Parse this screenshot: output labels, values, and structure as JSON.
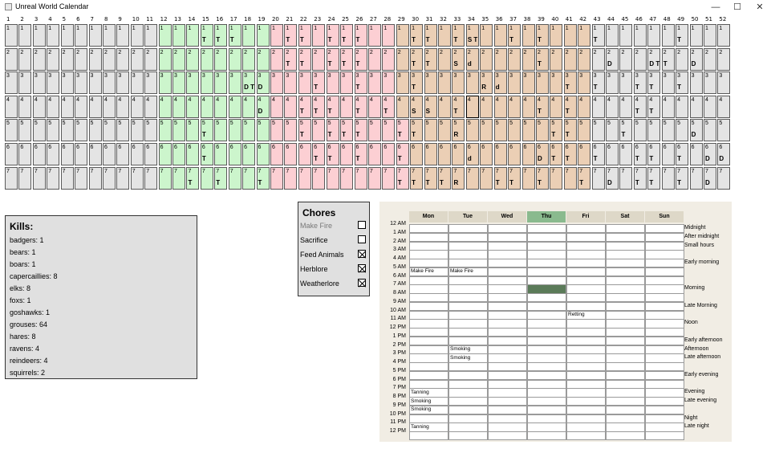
{
  "window": {
    "title": "Unreal World Calendar",
    "minimize": "—",
    "maximize": "☐",
    "close": "✕"
  },
  "calendar": {
    "weeks": [
      "1",
      "2",
      "3",
      "4",
      "5",
      "6",
      "7",
      "8",
      "9",
      "10",
      "11",
      "12",
      "13",
      "14",
      "15",
      "16",
      "17",
      "18",
      "19",
      "20",
      "21",
      "22",
      "23",
      "24",
      "25",
      "26",
      "27",
      "28",
      "29",
      "30",
      "31",
      "32",
      "33",
      "34",
      "35",
      "36",
      "37",
      "38",
      "39",
      "40",
      "41",
      "42",
      "43",
      "44",
      "45",
      "46",
      "47",
      "48",
      "49",
      "50",
      "51",
      "52"
    ],
    "days": [
      "1",
      "2",
      "3",
      "4",
      "5",
      "6",
      "7"
    ],
    "season_colors": {
      "winter": "#e4e4e4",
      "spring": "#ccf5cc",
      "summer": "#fccfd3",
      "autumn": "#ebcfb5"
    },
    "season_ranges": [
      {
        "season": "winter",
        "from": 1,
        "to": 11
      },
      {
        "season": "spring",
        "from": 12,
        "to": 19
      },
      {
        "season": "summer",
        "from": 20,
        "to": 28
      },
      {
        "season": "autumn",
        "from": 29,
        "to": 42
      },
      {
        "season": "winter",
        "from": 43,
        "to": 52
      }
    ],
    "season_exceptions": [
      {
        "week": 20,
        "day": 6,
        "season": "summer"
      },
      {
        "week": 20,
        "day": 7,
        "season": "summer"
      },
      {
        "week": 29,
        "day": 5,
        "season": "summer"
      },
      {
        "week": 29,
        "day": 6,
        "season": "summer"
      },
      {
        "week": 29,
        "day": 7,
        "season": "summer"
      }
    ],
    "selected": {
      "week": 34,
      "day": 4
    },
    "marks": [
      {
        "week": 15,
        "day": 1,
        "text": "T"
      },
      {
        "week": 16,
        "day": 1,
        "text": "T"
      },
      {
        "week": 17,
        "day": 1,
        "text": "T"
      },
      {
        "week": 21,
        "day": 1,
        "text": "T"
      },
      {
        "week": 22,
        "day": 1,
        "text": "T"
      },
      {
        "week": 24,
        "day": 1,
        "text": "T"
      },
      {
        "week": 25,
        "day": 1,
        "text": "T"
      },
      {
        "week": 26,
        "day": 1,
        "text": "T"
      },
      {
        "week": 30,
        "day": 1,
        "text": "T"
      },
      {
        "week": 31,
        "day": 1,
        "text": "T"
      },
      {
        "week": 33,
        "day": 1,
        "text": "T"
      },
      {
        "week": 34,
        "day": 1,
        "text": "S T"
      },
      {
        "week": 37,
        "day": 1,
        "text": "T"
      },
      {
        "week": 39,
        "day": 1,
        "text": "T"
      },
      {
        "week": 43,
        "day": 1,
        "text": "T"
      },
      {
        "week": 49,
        "day": 1,
        "text": "T"
      },
      {
        "week": 21,
        "day": 2,
        "text": "T"
      },
      {
        "week": 22,
        "day": 2,
        "text": "T"
      },
      {
        "week": 24,
        "day": 2,
        "text": "T"
      },
      {
        "week": 25,
        "day": 2,
        "text": "T"
      },
      {
        "week": 26,
        "day": 2,
        "text": "T"
      },
      {
        "week": 30,
        "day": 2,
        "text": "T"
      },
      {
        "week": 31,
        "day": 2,
        "text": "T"
      },
      {
        "week": 33,
        "day": 2,
        "text": "S"
      },
      {
        "week": 34,
        "day": 2,
        "text": "d"
      },
      {
        "week": 39,
        "day": 2,
        "text": "T"
      },
      {
        "week": 44,
        "day": 2,
        "text": "D"
      },
      {
        "week": 47,
        "day": 2,
        "text": "D T"
      },
      {
        "week": 48,
        "day": 2,
        "text": "T"
      },
      {
        "week": 50,
        "day": 2,
        "text": "D"
      },
      {
        "week": 18,
        "day": 3,
        "text": "D T"
      },
      {
        "week": 19,
        "day": 3,
        "text": "D"
      },
      {
        "week": 23,
        "day": 3,
        "text": "T"
      },
      {
        "week": 26,
        "day": 3,
        "text": "T"
      },
      {
        "week": 30,
        "day": 3,
        "text": "T"
      },
      {
        "week": 35,
        "day": 3,
        "text": "R"
      },
      {
        "week": 36,
        "day": 3,
        "text": "d"
      },
      {
        "week": 41,
        "day": 3,
        "text": "T"
      },
      {
        "week": 43,
        "day": 3,
        "text": "T"
      },
      {
        "week": 46,
        "day": 3,
        "text": "T"
      },
      {
        "week": 47,
        "day": 3,
        "text": "T"
      },
      {
        "week": 49,
        "day": 3,
        "text": "T"
      },
      {
        "week": 19,
        "day": 4,
        "text": "D"
      },
      {
        "week": 22,
        "day": 4,
        "text": "T"
      },
      {
        "week": 23,
        "day": 4,
        "text": "T"
      },
      {
        "week": 24,
        "day": 4,
        "text": "T"
      },
      {
        "week": 26,
        "day": 4,
        "text": "T"
      },
      {
        "week": 28,
        "day": 4,
        "text": "T"
      },
      {
        "week": 30,
        "day": 4,
        "text": "S"
      },
      {
        "week": 31,
        "day": 4,
        "text": "S"
      },
      {
        "week": 33,
        "day": 4,
        "text": "T"
      },
      {
        "week": 39,
        "day": 4,
        "text": "T"
      },
      {
        "week": 41,
        "day": 4,
        "text": "T"
      },
      {
        "week": 46,
        "day": 4,
        "text": "T"
      },
      {
        "week": 47,
        "day": 4,
        "text": "T"
      },
      {
        "week": 15,
        "day": 5,
        "text": "T"
      },
      {
        "week": 22,
        "day": 5,
        "text": "T"
      },
      {
        "week": 24,
        "day": 5,
        "text": "T"
      },
      {
        "week": 25,
        "day": 5,
        "text": "T"
      },
      {
        "week": 26,
        "day": 5,
        "text": "T"
      },
      {
        "week": 29,
        "day": 5,
        "text": "T"
      },
      {
        "week": 30,
        "day": 5,
        "text": "T"
      },
      {
        "week": 33,
        "day": 5,
        "text": "R"
      },
      {
        "week": 40,
        "day": 5,
        "text": "T"
      },
      {
        "week": 41,
        "day": 5,
        "text": "T"
      },
      {
        "week": 45,
        "day": 5,
        "text": "T"
      },
      {
        "week": 50,
        "day": 5,
        "text": "D"
      },
      {
        "week": 15,
        "day": 6,
        "text": "T"
      },
      {
        "week": 23,
        "day": 6,
        "text": "T"
      },
      {
        "week": 24,
        "day": 6,
        "text": "T"
      },
      {
        "week": 26,
        "day": 6,
        "text": "T"
      },
      {
        "week": 29,
        "day": 6,
        "text": "T"
      },
      {
        "week": 34,
        "day": 6,
        "text": "d"
      },
      {
        "week": 39,
        "day": 6,
        "text": "D"
      },
      {
        "week": 40,
        "day": 6,
        "text": "T"
      },
      {
        "week": 41,
        "day": 6,
        "text": "T"
      },
      {
        "week": 43,
        "day": 6,
        "text": "T"
      },
      {
        "week": 46,
        "day": 6,
        "text": "T"
      },
      {
        "week": 47,
        "day": 6,
        "text": "T"
      },
      {
        "week": 49,
        "day": 6,
        "text": "T"
      },
      {
        "week": 51,
        "day": 6,
        "text": "D"
      },
      {
        "week": 52,
        "day": 6,
        "text": "D"
      },
      {
        "week": 14,
        "day": 7,
        "text": "T"
      },
      {
        "week": 16,
        "day": 7,
        "text": "T"
      },
      {
        "week": 19,
        "day": 7,
        "text": "T"
      },
      {
        "week": 29,
        "day": 7,
        "text": "T"
      },
      {
        "week": 30,
        "day": 7,
        "text": "T"
      },
      {
        "week": 31,
        "day": 7,
        "text": "T"
      },
      {
        "week": 32,
        "day": 7,
        "text": "T"
      },
      {
        "week": 33,
        "day": 7,
        "text": "R"
      },
      {
        "week": 36,
        "day": 7,
        "text": "T"
      },
      {
        "week": 37,
        "day": 7,
        "text": "T"
      },
      {
        "week": 39,
        "day": 7,
        "text": "T"
      },
      {
        "week": 42,
        "day": 7,
        "text": "T"
      },
      {
        "week": 44,
        "day": 7,
        "text": "D"
      },
      {
        "week": 46,
        "day": 7,
        "text": "T"
      },
      {
        "week": 47,
        "day": 7,
        "text": "T"
      },
      {
        "week": 49,
        "day": 7,
        "text": "T"
      },
      {
        "week": 51,
        "day": 7,
        "text": "D"
      }
    ]
  },
  "kills": {
    "title": "Kills:",
    "items": [
      "badgers: 1",
      "bears: 1",
      "boars: 1",
      "capercaillies: 8",
      "elks: 8",
      "foxs: 1",
      "goshawks: 1",
      "grouses: 64",
      "hares: 8",
      "ravens: 4",
      "reindeers: 4",
      "squirrels: 2"
    ]
  },
  "chores": {
    "title": "Chores",
    "items": [
      {
        "label": "Make Fire",
        "checked": false,
        "dim": true
      },
      {
        "label": "Sacrifice",
        "checked": false,
        "dim": false
      },
      {
        "label": "Feed Animals",
        "checked": true,
        "dim": false
      },
      {
        "label": "Herblore",
        "checked": true,
        "dim": false
      },
      {
        "label": "Weatherlore",
        "checked": true,
        "dim": false
      }
    ]
  },
  "schedule": {
    "days": [
      "Mon",
      "Tue",
      "Wed",
      "Thu",
      "Fri",
      "Sat",
      "Sun"
    ],
    "today": "Thu",
    "hours": [
      "12 AM",
      "1 AM",
      "2 AM",
      "3 AM",
      "4 AM",
      "5 AM",
      "6 AM",
      "7 AM",
      "8 AM",
      "9 AM",
      "10 AM",
      "11 AM",
      "12 PM",
      "1 PM",
      "2 PM",
      "3 PM",
      "4 PM",
      "5 PM",
      "6 PM",
      "7 PM",
      "8 PM",
      "9 PM",
      "10 PM",
      "11 PM",
      "12 PM"
    ],
    "current_slot": {
      "day": "Thu",
      "hour": "7 AM"
    },
    "events": [
      {
        "day": "Mon",
        "hour": "5 AM",
        "text": "Make Fire"
      },
      {
        "day": "Tue",
        "hour": "5 AM",
        "text": "Make Fire"
      },
      {
        "day": "Fri",
        "hour": "10 AM",
        "text": "Retting"
      },
      {
        "day": "Tue",
        "hour": "2 PM",
        "text": "Smoking"
      },
      {
        "day": "Tue",
        "hour": "3 PM",
        "text": "Smoking"
      },
      {
        "day": "Mon",
        "hour": "7 PM",
        "text": "Tanning"
      },
      {
        "day": "Mon",
        "hour": "8 PM",
        "text": "Smoking"
      },
      {
        "day": "Mon",
        "hour": "9 PM",
        "text": "Smoking"
      },
      {
        "day": "Mon",
        "hour": "11 PM",
        "text": "Tanning"
      }
    ],
    "periods": [
      {
        "hour": "12 AM",
        "text": "Midnight"
      },
      {
        "hour": "1 AM",
        "text": "After midnight"
      },
      {
        "hour": "2 AM",
        "text": "Small hours"
      },
      {
        "hour": "4 AM",
        "text": "Early morning"
      },
      {
        "hour": "7 AM",
        "text": "Morning"
      },
      {
        "hour": "9 AM",
        "text": "Late Morning"
      },
      {
        "hour": "11 AM",
        "text": "Noon"
      },
      {
        "hour": "1 PM",
        "text": "Early afternoon"
      },
      {
        "hour": "2 PM",
        "text": "Afternoon"
      },
      {
        "hour": "3 PM",
        "text": "Late afternoon"
      },
      {
        "hour": "5 PM",
        "text": "Early evening"
      },
      {
        "hour": "7 PM",
        "text": "Evening"
      },
      {
        "hour": "8 PM",
        "text": "Late evening"
      },
      {
        "hour": "10 PM",
        "text": "Night"
      },
      {
        "hour": "11 PM",
        "text": "Late night"
      }
    ]
  }
}
